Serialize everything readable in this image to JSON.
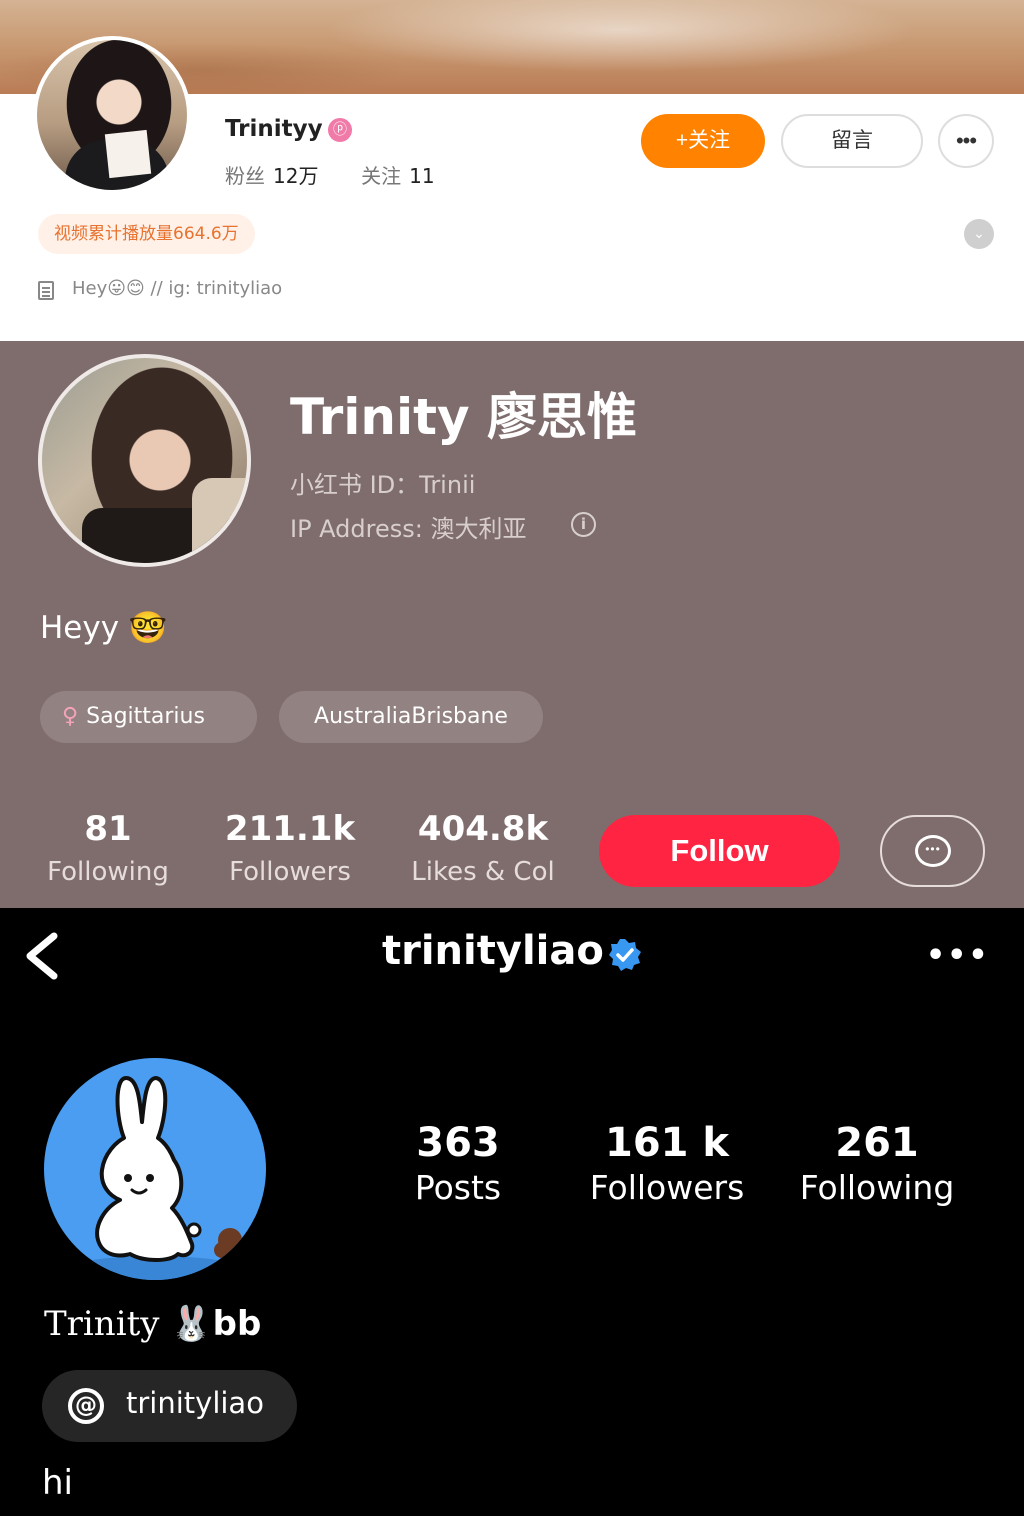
{
  "weibo": {
    "name": "Trinityy",
    "badge_icon": "weibo-vip-badge",
    "followers_label": "粉丝",
    "followers_value": "12万",
    "following_label": "关注",
    "following_value": "11",
    "follow_button": "+关注",
    "message_button": "留言",
    "more_button": "•••",
    "views_chip": "视频累计播放量664.6万",
    "bio": "Hey😛😊 // ig: trinityliao",
    "colors": {
      "accent": "#ff8200"
    }
  },
  "xiaohongshu": {
    "name": "Trinity 廖思惟",
    "id_line": "小红书 ID：Trinii",
    "ip_line": "IP Address: 澳大利亚",
    "info_icon": "i",
    "bio": "Heyy 🤓",
    "tags": [
      {
        "icon": "♀",
        "label": "Sagittarius"
      },
      {
        "label": "AustraliaBrisbane"
      }
    ],
    "stats": [
      {
        "value": "81",
        "label": "Following"
      },
      {
        "value": "211.1k",
        "label": "Followers"
      },
      {
        "value": "404.8k",
        "label": "Likes & Col"
      }
    ],
    "follow_button": "Follow",
    "chat_icon": "•••",
    "colors": {
      "accent": "#ff2442",
      "background": "#7e6d6c"
    }
  },
  "instagram": {
    "username": "trinityliao",
    "stats": [
      {
        "value": "363",
        "label": "Posts"
      },
      {
        "value": "161 k",
        "label": "Followers"
      },
      {
        "value": "261",
        "label": "Following"
      }
    ],
    "full_name": "Trinity",
    "full_name_emoji": "🐰",
    "full_name_suffix": "bb",
    "threads_icon": "@",
    "threads_label": "trinityliao",
    "bio": "hi",
    "colors": {
      "verified": "#3897f0"
    }
  }
}
